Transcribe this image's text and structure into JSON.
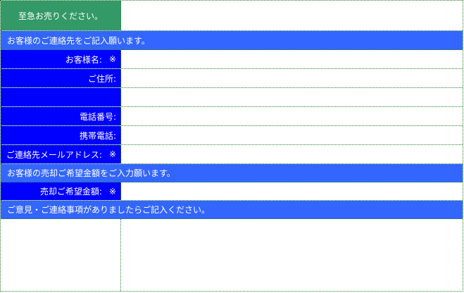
{
  "urgent": {
    "label": "至急お売りください。",
    "value": ""
  },
  "contact_section": {
    "title": "お客様のご連絡先をご記入願います。"
  },
  "fields": {
    "name": {
      "label": "お客様名:",
      "required_mark": "※",
      "value": ""
    },
    "address": {
      "label": "ご住所:",
      "value": ""
    },
    "address2": {
      "label": "",
      "value": ""
    },
    "phone": {
      "label": "電話番号:",
      "value": ""
    },
    "mobile": {
      "label": "携帯電話:",
      "value": ""
    },
    "email": {
      "label": "ご連絡先メールアドレス:",
      "required_mark": "※",
      "value": ""
    }
  },
  "price_section": {
    "title": "お客様の売却ご希望金額をご入力願います。"
  },
  "price": {
    "label": "売却ご希望金額:",
    "required_mark": "※",
    "value": ""
  },
  "comment_section": {
    "title": "ご意見・ご連絡事項がありましたらご記入ください。",
    "value": ""
  },
  "colors": {
    "label_blue": "#0000ff",
    "section_blue": "#3366ff",
    "urgent_green": "#339966",
    "border_green": "#2e7d32"
  }
}
